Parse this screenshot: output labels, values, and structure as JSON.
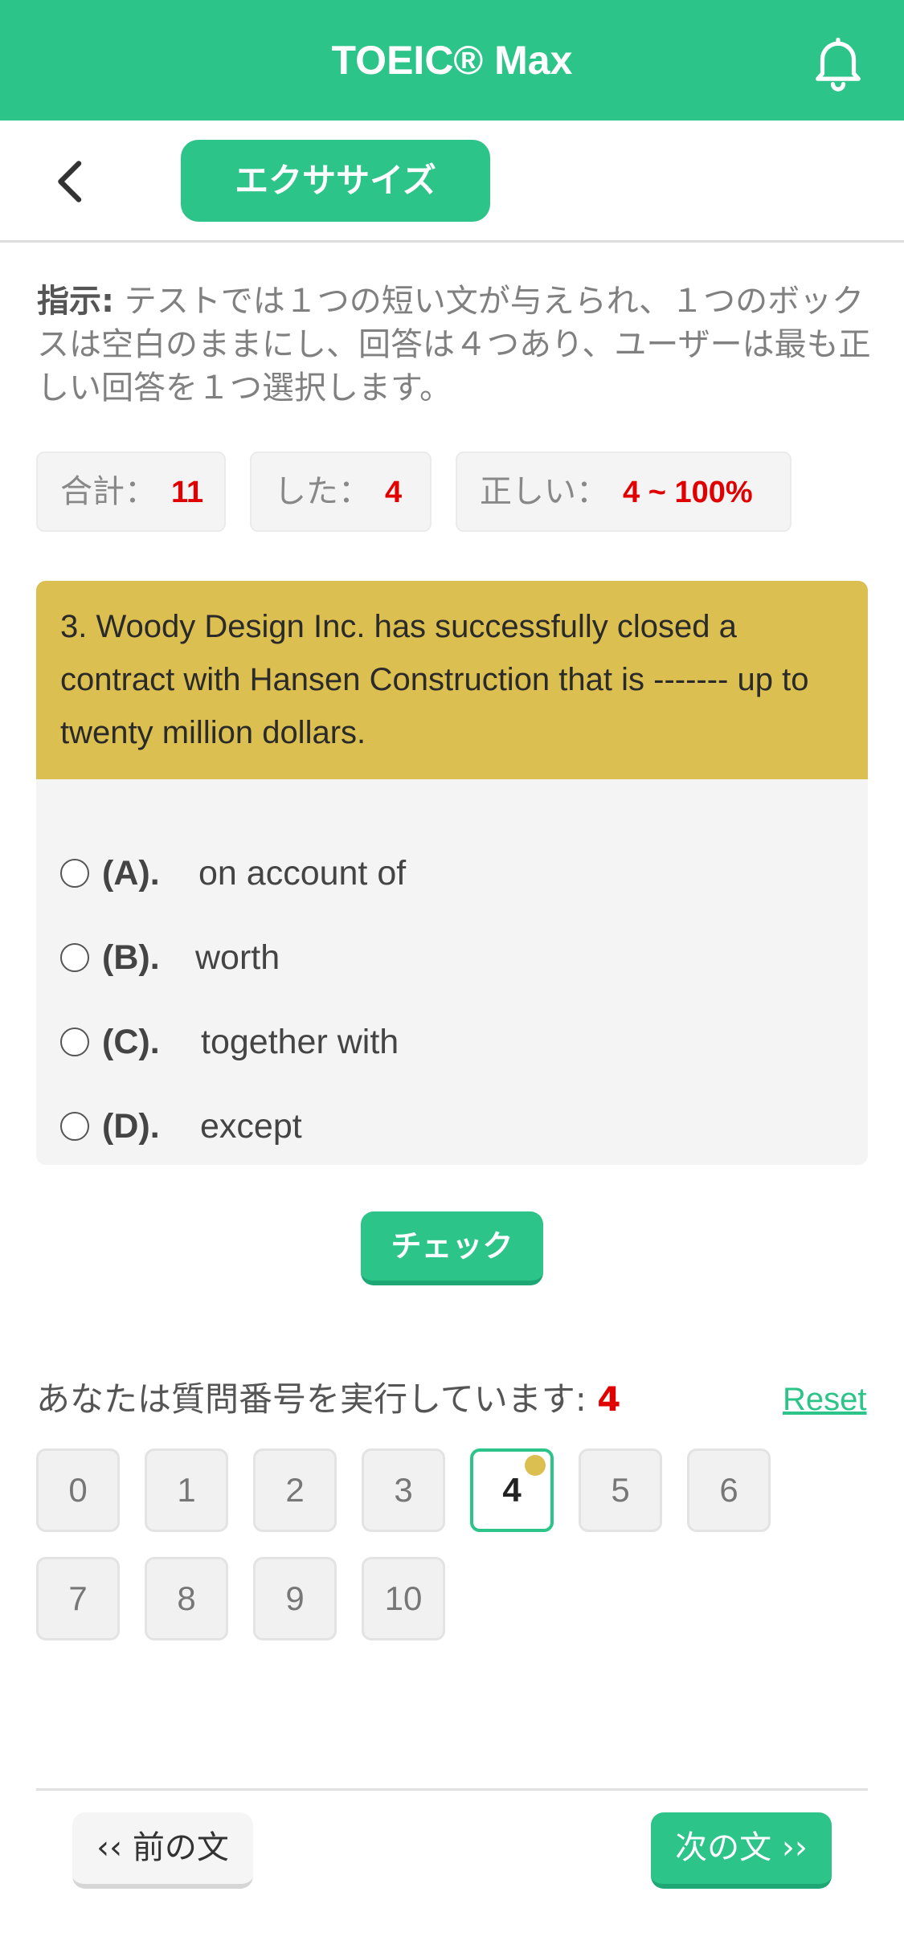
{
  "header": {
    "title": "TOEIC® Max",
    "bell_icon": "bell-icon"
  },
  "subheader": {
    "back_icon": "chevron-left-icon",
    "exercise_label": "エクササイズ"
  },
  "instruction": {
    "label": "指示:",
    "text": " テストでは１つの短い文が与えられ、１つのボックスは空白のままにし、回答は４つあり、ユーザーは最も正しい回答を１つ選択します。"
  },
  "stats": {
    "total_label": "合計：",
    "total_value": "11",
    "done_label": "した：",
    "done_value": "4",
    "correct_label": "正しい：",
    "correct_value": "4 ~ 100%"
  },
  "question": {
    "text": "3. Woody Design Inc. has successfully closed a contract with Hansen Construction that is ------- up to twenty million dollars.",
    "options": [
      {
        "letter": "(A).",
        "text": "on account of"
      },
      {
        "letter": "(B).",
        "text": "worth"
      },
      {
        "letter": "(C).",
        "text": "together with"
      },
      {
        "letter": "(D).",
        "text": "except"
      }
    ]
  },
  "check_label": "チェック",
  "progress": {
    "text": "あなたは質問番号を実行しています:",
    "current": "4",
    "reset_label": "Reset",
    "numbers": [
      "0",
      "1",
      "2",
      "3",
      "4",
      "5",
      "6",
      "7",
      "8",
      "9",
      "10"
    ],
    "active": "4"
  },
  "nav": {
    "prev_label": "‹‹ 前の文",
    "next_label": "次の文 ››"
  },
  "colors": {
    "primary": "#2dc48a",
    "question_bg": "#dbbf50",
    "accent_red": "#e00000"
  }
}
